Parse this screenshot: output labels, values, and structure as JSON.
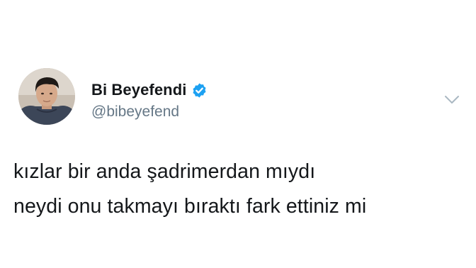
{
  "tweet": {
    "author": {
      "display_name": "Bi Beyefendi",
      "handle": "@bibeyefend",
      "verified": true,
      "avatar_icon": "profile-photo"
    },
    "menu_icon": "chevron-down-icon",
    "text_lines": [
      "kızlar bir anda şadrimerdan mıydı",
      "neydi onu takmayı bıraktı fark ettiniz mi"
    ]
  },
  "colors": {
    "background": "#ffffff",
    "text_primary": "#14171a",
    "text_secondary": "#657786",
    "verified_badge": "#1da1f2",
    "chevron": "#aab8c2"
  }
}
